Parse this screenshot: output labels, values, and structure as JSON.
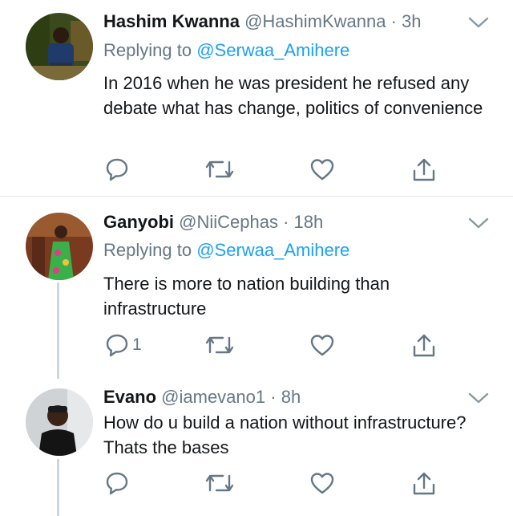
{
  "tweets": [
    {
      "name": "Hashim Kwanna",
      "handle": "@HashimKwanna",
      "separator": "·",
      "time": "3h",
      "replying_prefix": "Replying to ",
      "replying_to": "@Serwaa_Amihere",
      "text": "In 2016 when he was president he refused any debate what has change, politics of convenience",
      "reply_count": "",
      "retweet_count": "",
      "like_count": ""
    },
    {
      "name": "Ganyobi",
      "handle": "@NiiCephas",
      "separator": "·",
      "time": "18h",
      "replying_prefix": "Replying to ",
      "replying_to": "@Serwaa_Amihere",
      "text": "There is more to nation building than infrastructure",
      "reply_count": "1",
      "retweet_count": "",
      "like_count": ""
    },
    {
      "name": "Evano",
      "handle": "@iamevano1",
      "separator": "·",
      "time": "8h",
      "text": "How do u build a nation without infrastructure?Thats the bases",
      "reply_count": "",
      "retweet_count": "",
      "like_count": ""
    }
  ],
  "icons": {
    "reply": "reply-icon",
    "retweet": "retweet-icon",
    "like": "heart-icon",
    "share": "share-icon",
    "menu": "chevron-down-icon"
  },
  "colors": {
    "link": "#1da1f2",
    "secondary_text": "#657786",
    "primary_text": "#14171a",
    "divider": "#e1e8ed"
  }
}
